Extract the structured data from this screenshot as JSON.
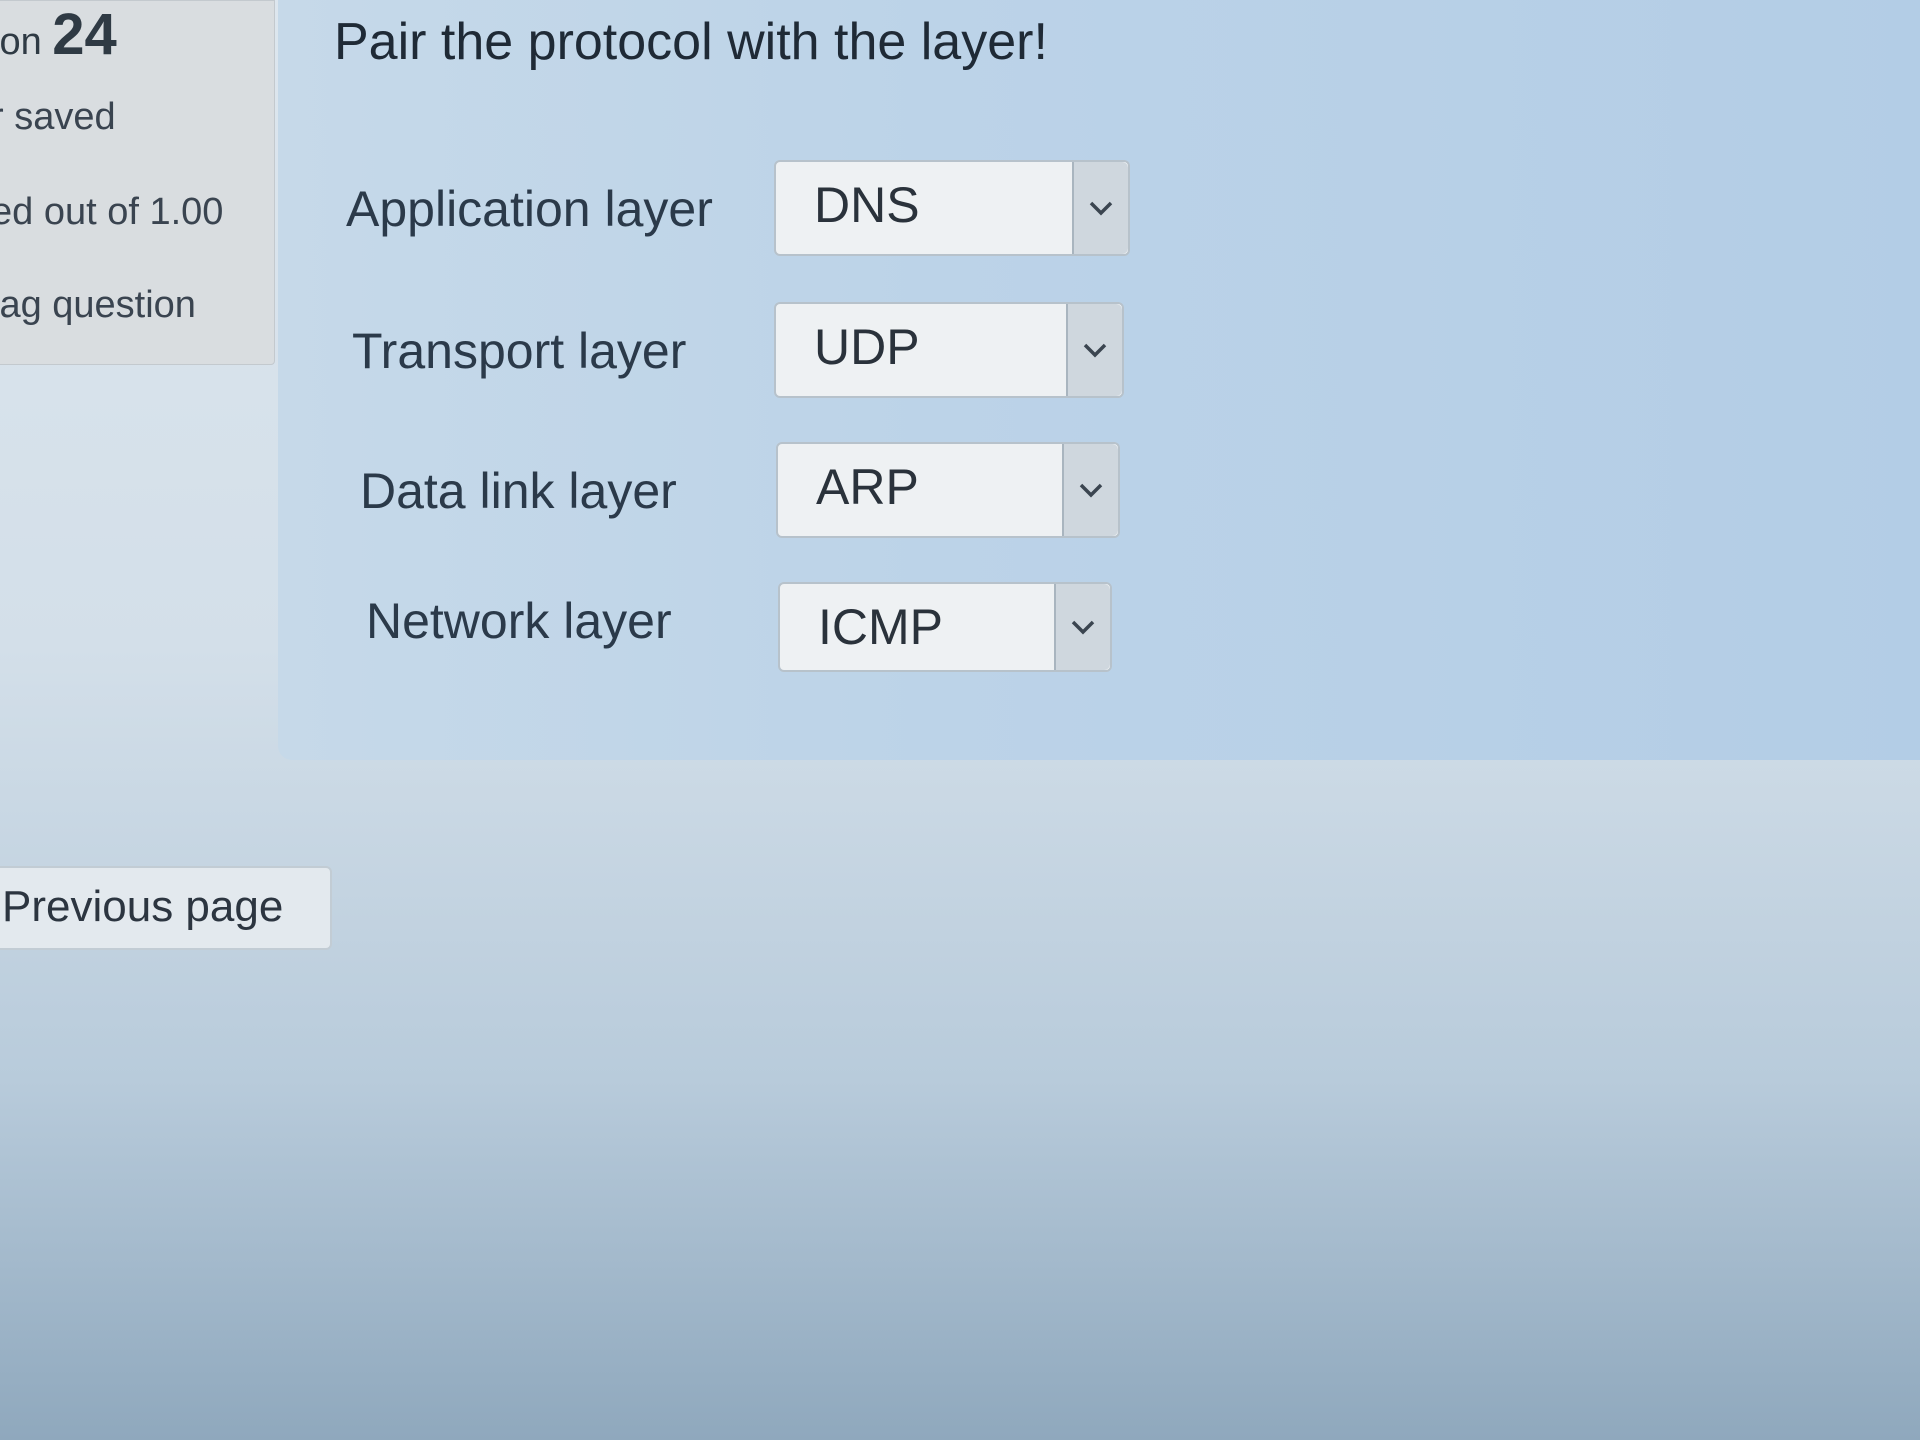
{
  "info": {
    "number_prefix": "ion",
    "number": "24",
    "status": "r saved",
    "mark": "ed out of 1.00",
    "flag": "lag question"
  },
  "question": {
    "text": "Pair the protocol with the layer!",
    "rows": [
      {
        "label": "Application layer",
        "selected": "DNS"
      },
      {
        "label": "Transport layer",
        "selected": "UDP"
      },
      {
        "label": "Data link layer",
        "selected": "ARP"
      },
      {
        "label": "Network layer",
        "selected": "ICMP"
      }
    ]
  },
  "navigation": {
    "previous_label": "Previous page"
  },
  "icons": {
    "dropdown": "chevron-down-icon"
  },
  "colors": {
    "panel": "#bcd3e8",
    "info_box": "#d9dde0",
    "background": "#d3dfe9"
  }
}
